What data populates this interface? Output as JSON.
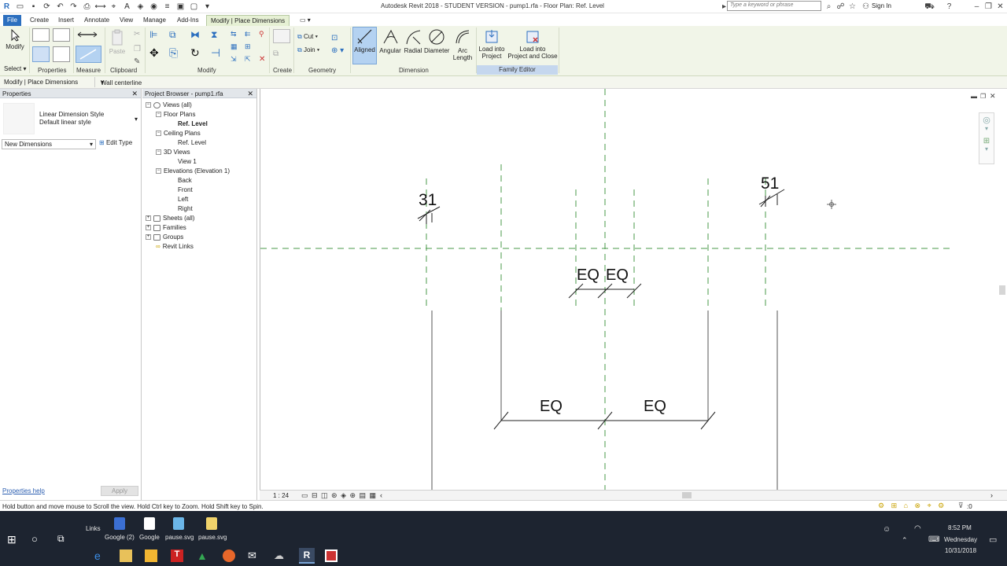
{
  "window": {
    "title": "Autodesk Revit 2018 - STUDENT VERSION -    pump1.rfa - Floor Plan: Ref. Level",
    "search_placeholder": "Type a keyword or phrase",
    "sign_in": "Sign In"
  },
  "ribbon_tabs": [
    "File",
    "Create",
    "Insert",
    "Annotate",
    "View",
    "Manage",
    "Add-Ins",
    "Modify | Place Dimensions"
  ],
  "active_tab": "Modify | Place Dimensions",
  "ribbon": {
    "modify_label": "Modify",
    "select_label": "Select",
    "properties_label": "Properties",
    "measure_label": "Measure",
    "paste_label": "Paste",
    "clipboard_label": "Clipboard",
    "modify_panel_label": "Modify",
    "cut_label": "Cut",
    "join_label": "Join",
    "create_label": "Create",
    "geometry_label": "Geometry",
    "aligned_label": "Aligned",
    "angular_label": "Angular",
    "radial_label": "Radial",
    "diameter_label": "Diameter",
    "arc_length_line1": "Arc",
    "arc_length_line2": "Length",
    "dimension_label": "Dimension",
    "load_into_project_line1": "Load into",
    "load_into_project_line2": "Project",
    "load_close_line1": "Load into",
    "load_close_line2": "Project and Close",
    "family_editor_label": "Family Editor"
  },
  "options_bar": {
    "context": "Modify | Place Dimensions",
    "placement": "Wall centerline"
  },
  "properties": {
    "title": "Properties",
    "type_family": "Linear Dimension Style",
    "type_name": "Default linear style",
    "instance_filter": "New Dimensions",
    "edit_type": "Edit Type",
    "help_link": "Properties help",
    "apply": "Apply"
  },
  "project_browser": {
    "title": "Project Browser - pump1.rfa",
    "items": [
      {
        "label": "Views (all)",
        "toggle": "-"
      },
      {
        "label": "Floor Plans",
        "toggle": "-"
      },
      {
        "label": "Ref. Level",
        "toggle": ""
      },
      {
        "label": "Ceiling Plans",
        "toggle": "-"
      },
      {
        "label": "Ref. Level",
        "toggle": ""
      },
      {
        "label": "3D Views",
        "toggle": "-"
      },
      {
        "label": "View 1",
        "toggle": ""
      },
      {
        "label": "Elevations (Elevation 1)",
        "toggle": "-"
      },
      {
        "label": "Back",
        "toggle": ""
      },
      {
        "label": "Front",
        "toggle": ""
      },
      {
        "label": "Left",
        "toggle": ""
      },
      {
        "label": "Right",
        "toggle": ""
      },
      {
        "label": "Sheets (all)",
        "toggle": ""
      },
      {
        "label": "Families",
        "toggle": "+"
      },
      {
        "label": "Groups",
        "toggle": "+"
      },
      {
        "label": "Revit Links",
        "toggle": ""
      }
    ]
  },
  "drawing": {
    "dim_left": "31",
    "dim_right": "51",
    "eq_top_left": "EQ",
    "eq_top_right": "EQ",
    "eq_bottom_left": "EQ",
    "eq_bottom_right": "EQ"
  },
  "view_controls": {
    "scale": "1 : 24"
  },
  "status": {
    "message": "Hold button and move mouse to Scroll the view. Hold Ctrl key to Zoom. Hold Shift key to Spin.",
    "filter_count": ":0"
  },
  "taskbar": {
    "links_label": "Links",
    "desktop_items": [
      "Google (2)",
      "Google",
      "pause.svg",
      "pause.svg"
    ],
    "time": "8:52 PM",
    "day": "Wednesday",
    "date": "10/31/2018"
  }
}
